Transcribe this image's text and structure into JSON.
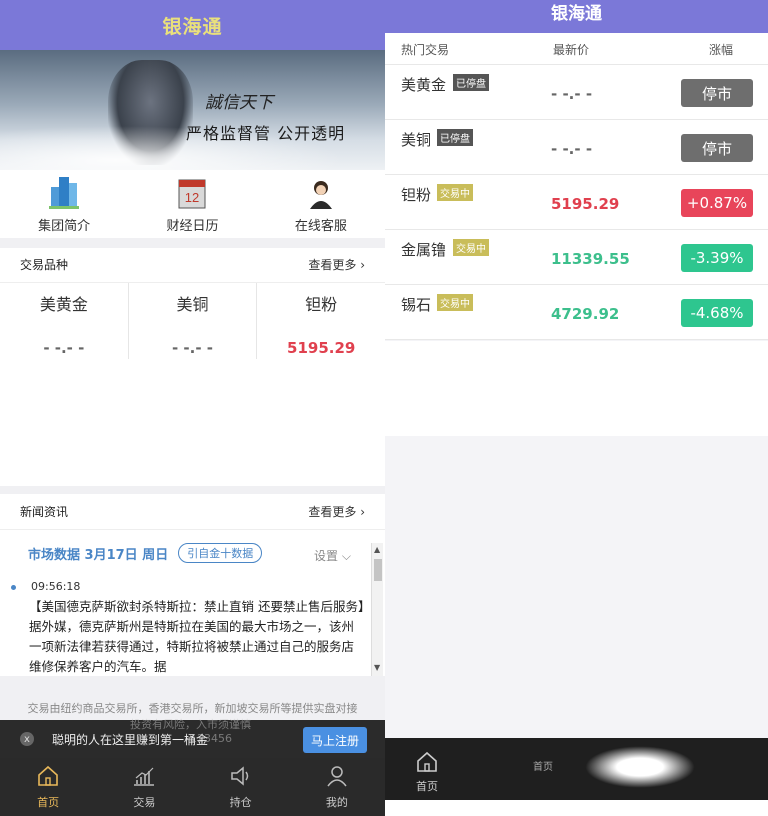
{
  "left": {
    "app_title": "银海通",
    "banner": {
      "script_text": "誠信天下",
      "slogan": "严格监督管  公开透明"
    },
    "quick_links": [
      {
        "label": "集团简介",
        "icon": "building-icon"
      },
      {
        "label": "财经日历",
        "icon": "calendar-icon",
        "badge": "12"
      },
      {
        "label": "在线客服",
        "icon": "customer-service-icon"
      }
    ],
    "trade_section": {
      "title": "交易品种",
      "more": "查看更多 ›"
    },
    "products": [
      {
        "name": "美黄金",
        "price": "- -.- -"
      },
      {
        "name": "美铜",
        "price": "- -.- -"
      },
      {
        "name": "钽粉",
        "price": "5195.29",
        "trend": "up"
      }
    ],
    "news_section": {
      "title": "新闻资讯",
      "more": "查看更多 ›"
    },
    "news": {
      "date": "市场数据 3月17日 周日",
      "source": "引自金十数据",
      "settings": "设置 ⌵",
      "time": "09:56:18",
      "body": "【美国德克萨斯欲封杀特斯拉：禁止直销 还要禁止售后服务】据外媒，德克萨斯州是特斯拉在美国的最大市场之一，该州一项新法律若获得通过，特斯拉将被禁止通过自己的服务店维修保养客户的汽车。据"
    },
    "disclaimer": "交易由纽约商品交易所，香港交易所，新加坡交易所等提供实盘对接",
    "promo": {
      "close": "x",
      "text": "聪明的人在这里赚到第一桶金",
      "button": "马上注册",
      "ghost_line1": "投资有风险，入市须谨慎",
      "ghost_line2": "123456"
    },
    "tabs": [
      {
        "label": "首页",
        "icon": "home-icon",
        "active": true
      },
      {
        "label": "交易",
        "icon": "chart-icon",
        "active": false
      },
      {
        "label": "持仓",
        "icon": "speaker-icon",
        "active": false
      },
      {
        "label": "我的",
        "icon": "user-icon",
        "active": false
      }
    ]
  },
  "right": {
    "app_title": "银海通",
    "columns": {
      "name": "热门交易",
      "price": "最新价",
      "change": "涨幅"
    },
    "rows": [
      {
        "name": "美黄金",
        "status": "已停盘",
        "status_type": "stop",
        "price": "- -.- -",
        "trend": "flat",
        "change": "停市",
        "change_type": "stop"
      },
      {
        "name": "美铜",
        "status": "已停盘",
        "status_type": "stop",
        "price": "- -.- -",
        "trend": "flat",
        "change": "停市",
        "change_type": "stop"
      },
      {
        "name": "钽粉",
        "status": "交易中",
        "status_type": "trade",
        "price": "5195.29",
        "trend": "up",
        "change": "+0.87%",
        "change_type": "up"
      },
      {
        "name": "金属镥",
        "status": "交易中",
        "status_type": "trade",
        "price": "11339.55",
        "trend": "down",
        "change": "-3.39%",
        "change_type": "down"
      },
      {
        "name": "锡石",
        "status": "交易中",
        "status_type": "trade",
        "price": "4729.92",
        "trend": "down",
        "change": "-4.68%",
        "change_type": "down"
      }
    ],
    "tabbar": {
      "home_label": "首页",
      "ghost_label": "首页"
    }
  },
  "colors": {
    "header": "#7b78d8",
    "title_gold": "#e9e07c",
    "up": "#e8455a",
    "down": "#2ec68f",
    "stop": "#6e6e6e",
    "link_blue": "#4a86c6",
    "tab_active": "#e8b85a"
  }
}
